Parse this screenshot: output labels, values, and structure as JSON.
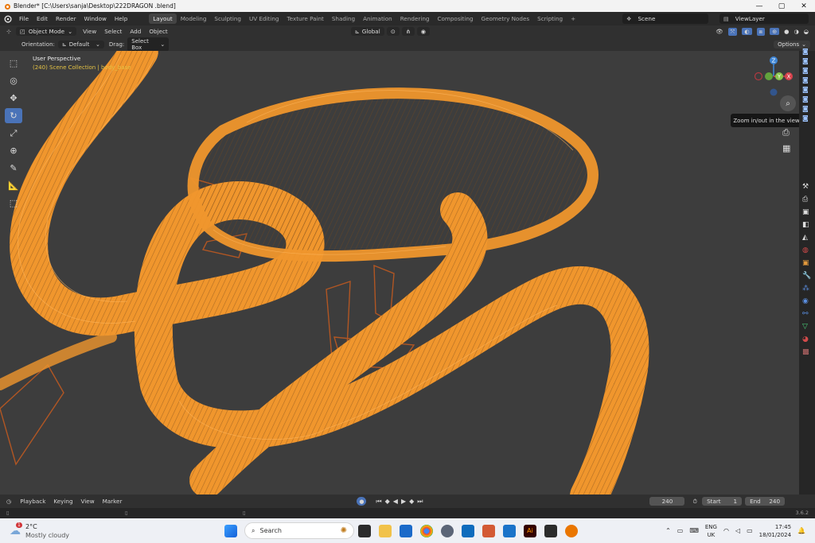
{
  "window": {
    "title": "Blender* [C:\\Users\\sanja\\Desktop\\222DRAGON .blend]",
    "minimize": "—",
    "maximize": "▢",
    "close": "✕"
  },
  "menu": [
    "File",
    "Edit",
    "Render",
    "Window",
    "Help"
  ],
  "workspaces": [
    "Layout",
    "Modeling",
    "Sculpting",
    "UV Editing",
    "Texture Paint",
    "Shading",
    "Animation",
    "Rendering",
    "Compositing",
    "Geometry Nodes",
    "Scripting"
  ],
  "add_workspace": "+",
  "scene": {
    "label": "Scene",
    "view_layer": "ViewLayer"
  },
  "header": {
    "mode": "Object Mode",
    "menus": [
      "View",
      "Select",
      "Add",
      "Object"
    ],
    "transform": "Global",
    "options": "Options"
  },
  "tool_settings": {
    "orientation_label": "Orientation:",
    "orientation_value": "Default",
    "drag_label": "Drag:",
    "drag_value": "Select Box"
  },
  "viewport": {
    "perspective": "User Perspective",
    "collection": "(240) Scene Collection | body_base",
    "tooltip": "Zoom in/out in the view",
    "gizmo": {
      "z": "Z",
      "y": "Y",
      "x": "X"
    }
  },
  "timeline": {
    "menus": [
      "Playback",
      "Keying",
      "View",
      "Marker"
    ],
    "current_frame": "240",
    "start_label": "Start",
    "start_value": "1",
    "end_label": "End",
    "end_value": "240"
  },
  "status": {
    "version": "3.6.2"
  },
  "taskbar": {
    "weather_temp": "2°C",
    "weather_desc": "Mostly cloudy",
    "weather_badge": "1",
    "search_placeholder": "Search",
    "lang": "ENG",
    "region": "UK",
    "time": "17:45",
    "date": "18/01/2024"
  },
  "colors": {
    "wire": "#f0962d",
    "wire_dark": "#c65a1f",
    "accent": "#4a73b8",
    "bg": "#3d3d3d"
  }
}
